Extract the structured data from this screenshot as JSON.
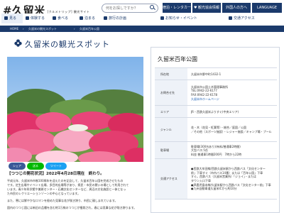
{
  "header": {
    "logo": "#久留米",
    "logo_sub": "[クルメトリップ] 観光サイト",
    "search_placeholder": "何をお探しですか？",
    "buttons": [
      "宿泊・レンタカー",
      "♥ 観光協会情報",
      "外国人の方へ",
      "LANGUAGE"
    ]
  },
  "nav": [
    "見る",
    "体験する",
    "食べる",
    "泊まる",
    "旅行の計画",
    "お知らせ・イベント",
    "交通アクセス"
  ],
  "breadcrumb": [
    "HOME",
    "久留米の観光スポット",
    "久留米百年公園"
  ],
  "page_title": "久留米の観光スポット",
  "photo_caption": "",
  "share": {
    "facebook": "シェア",
    "line": "送る",
    "tweet": "ツイート"
  },
  "news_heading": "【つつじの開花状況】2022年4月28日現在　終わり。",
  "body_lines": [
    "平成元年、久留米市市制100周年を迎えたのを記念して、久留米百年公園を完成させたもの",
    "です。芝生広場やイベント広場、多目的広場等があり、県民・市民の憩いの場として利用されて",
    "います。青少年科学館や美術センター・石橋文化センターなど、周辺の文化施設と一体となっ",
    "た市民のレクリエーションゾーンの中心となっています。",
    "また、寒には鮮やかなロマンを極めた見事な花が咲き誇り、市民に親しまれています。",
    "園内のつつじ園には新旧の品種を含む約1万株のつつじが植栽され、春には見事な花が咲き誇ります。"
  ],
  "spot": {
    "name": "久留米百年公園",
    "rows": [
      {
        "key": "所在地",
        "values": [
          "久留米市野中町1432-1"
        ]
      },
      {
        "key": "お問合せ先",
        "values": [
          "久留米市公園土木管理事務所",
          "TEL:0942-22-6177",
          "FAX:0942-22-6178",
          "久留米市ホームページ"
        ]
      },
      {
        "key": "エリア",
        "values": [
          "JR・西鉄久留米よりすぐ(中央エリア)"
        ]
      },
      {
        "key": "ジャンル",
        "values": [
          "花・木（花見・紅葉等）・総合／庭園／公園",
          "／その他（スポーツ施設）・レジャー施設／キャンプ場・プール"
        ]
      },
      {
        "key": "駐車場",
        "values": [
          "駐車場(300台あり)(有料/普通車2時間)",
          "大型バス:5台",
          "料金:普通車1時間200円　7時から22時"
        ]
      },
      {
        "key": "交通アクセス",
        "values": [
          "●西鉄大牟田線/西鉄久留米駅から西鉄バス「文化センター",
          "前」下車すぐ（市内バス14番）または「百年公園」下車",
          "すぐ。西鉄バス（久留米営業所）「ジョイ」・または",
          "タウン入口下車",
          "●JR鹿児島本線/久留米駅から西鉄バス「文化センター前」下車",
          "●九州自動車道久留米ICから約10分"
        ]
      }
    ]
  },
  "colors": {
    "navy": "#1b3a6b",
    "panel_border": "#cfd6e2",
    "label_bg": "#eef2f8"
  }
}
